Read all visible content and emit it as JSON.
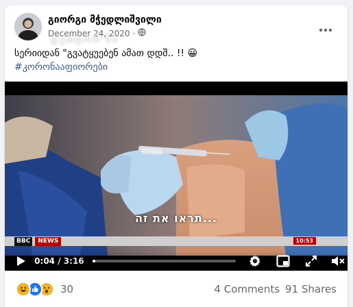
{
  "post": {
    "author": "გიორგი მჭედლიშვილი",
    "date": "December 24, 2020",
    "privacy_icon": "globe-icon",
    "watermark": "დეთტორ ნა",
    "text": "სერიიდან \"გვატყუებენ ამათ დდშ.. !! 😀",
    "hashtag": "#კორონააფიორები"
  },
  "video": {
    "subtitle": "תראו את זה...",
    "channel_logo": "BBC",
    "channel_label": "NEWS",
    "clock": "10:53",
    "current_time": "0:04",
    "time_separator": "/",
    "duration": "3:16",
    "progress_fraction": 0.02
  },
  "engagement": {
    "reactions": [
      "haha",
      "like",
      "wow"
    ],
    "reaction_count": "30",
    "comments": "4 Comments",
    "shares": "91 Shares"
  },
  "colors": {
    "link": "#385898",
    "like": "#1877f2",
    "emoji": "#f7b125",
    "news_red": "#b80000"
  }
}
